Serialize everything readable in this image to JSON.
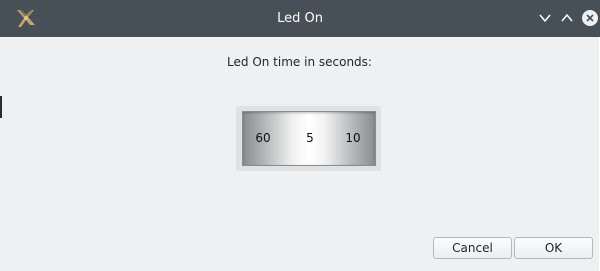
{
  "window": {
    "title": "Led On",
    "app_icon": "app-logo-icon",
    "controls": [
      "minimize-icon",
      "maximize-icon",
      "close-icon"
    ]
  },
  "dialog": {
    "prompt": "Led On time in seconds:",
    "spinner": {
      "previous_value": "60",
      "current_value": "5",
      "next_value": "10"
    }
  },
  "buttons": {
    "cancel_label": "Cancel",
    "ok_label": "OK"
  },
  "colors": {
    "titlebar": "#475057",
    "window_background": "#eff0f1"
  }
}
